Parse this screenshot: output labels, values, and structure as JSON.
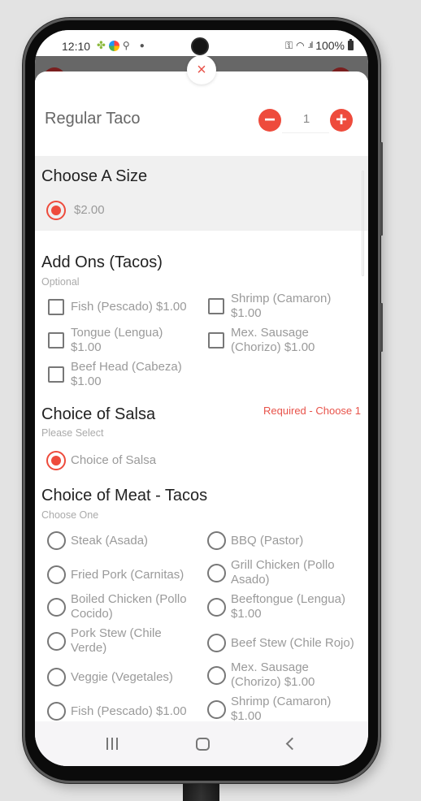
{
  "status_bar": {
    "time": "12:10",
    "left_icons": [
      "android-icon",
      "app-color-icon",
      "location-icon",
      "dot-icon"
    ],
    "right_icons": [
      "vpn-key-icon",
      "wifi-icon",
      "signal-icon"
    ],
    "battery": "100%"
  },
  "modal": {
    "close_icon": "×",
    "item": {
      "name": "Regular Taco",
      "quantity": "1",
      "minus_label": "−",
      "plus_label": "+"
    },
    "sections": {
      "size": {
        "title": "Choose A Size",
        "options": [
          {
            "label": "$2.00",
            "selected": true
          }
        ]
      },
      "addons": {
        "title": "Add Ons (Tacos)",
        "subtitle": "Optional",
        "options": [
          {
            "label": "Fish (Pescado) $1.00",
            "checked": false
          },
          {
            "label": "Shrimp (Camaron) $1.00",
            "checked": false
          },
          {
            "label": "Tongue (Lengua) $1.00",
            "checked": false
          },
          {
            "label": "Mex. Sausage (Chorizo) $1.00",
            "checked": false
          },
          {
            "label": "Beef Head (Cabeza) $1.00",
            "checked": false
          }
        ]
      },
      "salsa": {
        "title": "Choice of Salsa",
        "subtitle": "Please Select",
        "required": "Required - Choose 1",
        "options": [
          {
            "label": "Choice of Salsa",
            "selected": true
          }
        ]
      },
      "meat": {
        "title": "Choice of Meat - Tacos",
        "subtitle": "Choose One",
        "options": [
          {
            "label": "Steak (Asada)",
            "selected": false
          },
          {
            "label": "BBQ (Pastor)",
            "selected": false
          },
          {
            "label": "Fried Pork (Carnitas)",
            "selected": false
          },
          {
            "label": "Grill Chicken (Pollo Asado)",
            "selected": false
          },
          {
            "label": "Boiled Chicken (Pollo Cocido)",
            "selected": false
          },
          {
            "label": "Beeftongue (Lengua) $1.00",
            "selected": false
          },
          {
            "label": "Pork Stew (Chile Verde)",
            "selected": false
          },
          {
            "label": "Beef Stew (Chile Rojo)",
            "selected": false
          },
          {
            "label": "Veggie (Vegetales)",
            "selected": false
          },
          {
            "label": "Mex. Sausage (Chorizo) $1.00",
            "selected": false
          },
          {
            "label": "Fish (Pescado) $1.00",
            "selected": false
          },
          {
            "label": "Shrimp (Camaron) $1.00",
            "selected": false
          }
        ]
      }
    }
  },
  "nav_bar": {
    "buttons": [
      "recents",
      "home",
      "back"
    ]
  },
  "colors": {
    "accent": "#ee4b3c",
    "required_text": "#e8534a",
    "section_gray": "#f0f0f0",
    "backdrop": "#676767"
  }
}
